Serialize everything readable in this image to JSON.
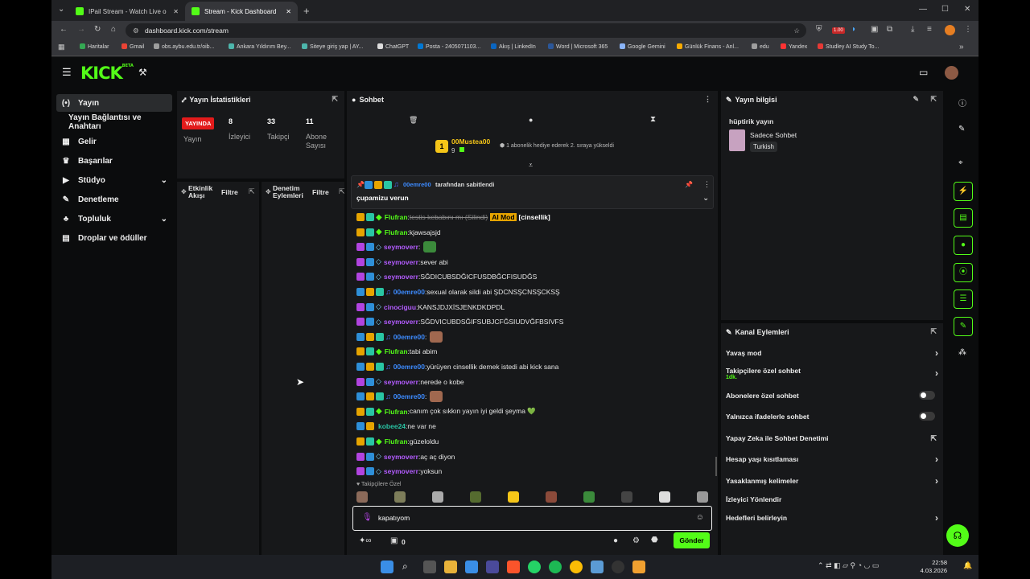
{
  "browser": {
    "tabs": [
      {
        "title": "IPail Stream - Watch Live o"
      },
      {
        "title": "Stream - Kick Dashboard"
      }
    ],
    "url": "dashboard.kick.com/stream",
    "bookmarks": [
      "Haritalar",
      "Gmail",
      "obs.aybu.edu.tr/oib...",
      "Ankara Yıldırım Bey...",
      "Siteye giriş yap | AY...",
      "ChatGPT",
      "Posta - 2405071103...",
      "Akış | LinkedIn",
      "Word | Microsoft 365",
      "Google Gemini",
      "Günlük Finans - Anl...",
      "edu",
      "Yandex",
      "Studley AI Study To..."
    ],
    "profile_badge": "1.00"
  },
  "kick": {
    "logo": "KICK",
    "logo_sup": "BETA",
    "sidebar": [
      {
        "icon": "(•)",
        "label": "Yayın"
      },
      {
        "icon": "",
        "label": "Yayın Bağlantısı ve Anahtarı"
      },
      {
        "icon": "▦",
        "label": "Gelir"
      },
      {
        "icon": "♛",
        "label": "Başarılar"
      },
      {
        "icon": "▶",
        "label": "Stüdyo"
      },
      {
        "icon": "✎",
        "label": "Denetleme"
      },
      {
        "icon": "♣",
        "label": "Topluluk"
      },
      {
        "icon": "▤",
        "label": "Droplar ve ödüller"
      }
    ],
    "stats": {
      "title": "Yayın İstatistikleri",
      "live_badge": "YAYINDA",
      "status_label": "Yayın",
      "viewers_value": "8",
      "viewers_label": "İzleyici",
      "followers_value": "33",
      "followers_label": "Takipçi",
      "subs_value": "11",
      "subs_label1": "Abone",
      "subs_label2": "Sayısı"
    },
    "activity": {
      "title1": "Etkinlik",
      "title2": "Akışı",
      "filter": "Filtre"
    },
    "moderation": {
      "title1": "Denetim",
      "title2": "Eylemleri",
      "filter": "Filtre"
    },
    "chat": {
      "title": "Sohbet",
      "gift_user": "00Mustea00",
      "gift_count": "9",
      "gift_rank": "1",
      "gift_text": "1 abonelik hediye ederek 2. sıraya yükseldi",
      "pinned_by_user": "00emre00",
      "pinned_by_text": "tarafından sabitlendi",
      "pinned_text": "çupamizu verun",
      "messages": [
        {
          "user": "Flufran",
          "color": "#53fc18",
          "text": "testis kebabını mı (Silindi)",
          "mod": "AI Mod",
          "tag": "[cinsellik]"
        },
        {
          "user": "Flufran",
          "color": "#53fc18",
          "text": "kjawsajsjd"
        },
        {
          "user": "seymoverr",
          "color": "#b35cff",
          "text": ""
        },
        {
          "user": "seymoverr",
          "color": "#b35cff",
          "text": "sever abi"
        },
        {
          "user": "seymoverr",
          "color": "#b35cff",
          "text": "SĞDICUBSDĞICFUSDBĞCFISUDĞS"
        },
        {
          "user": "00emre00",
          "color": "#3d8bff",
          "text": "sexual olarak sildi abi ŞDCNSŞCNSŞCKSŞ"
        },
        {
          "user": "cinociguu",
          "color": "#b35cff",
          "text": "KANSJDJXİSJENKDKDPDL"
        },
        {
          "user": "seymoverr",
          "color": "#b35cff",
          "text": "SĞDVICUBDSĞIFSUBJCFĞSIUDVĞFBSIVFS"
        },
        {
          "user": "00emre00",
          "color": "#3d8bff",
          "text": ""
        },
        {
          "user": "Flufran",
          "color": "#53fc18",
          "text": "tabi abim"
        },
        {
          "user": "00emre00",
          "color": "#3d8bff",
          "text": "yürüyen cinsellik demek istedi abi kick sana"
        },
        {
          "user": "seymoverr",
          "color": "#b35cff",
          "text": "nerede o kobe"
        },
        {
          "user": "00emre00",
          "color": "#3d8bff",
          "text": ""
        },
        {
          "user": "Flufran",
          "color": "#53fc18",
          "text": "canım çok sıkkın yayın iyi geldi şeyma 💚"
        },
        {
          "user": "kobee24",
          "color": "#29c5a4",
          "text": "ne var ne"
        },
        {
          "user": "Flufran",
          "color": "#53fc18",
          "text": "güzeloldu"
        },
        {
          "user": "seymoverr",
          "color": "#b35cff",
          "text": "aç aç diyon"
        },
        {
          "user": "seymoverr",
          "color": "#b35cff",
          "text": "yoksun"
        }
      ],
      "emote_section": "Takipçilere Özel",
      "input_value": "kapatıyom",
      "points": "0",
      "send_label": "Gönder"
    },
    "stream_info": {
      "title": "Yayın bilgisi",
      "stream_title": "hüptirik yayın",
      "category": "Sadece Sohbet",
      "language": "Turkish"
    },
    "channel_actions": {
      "title": "Kanal Eylemleri",
      "items": [
        {
          "label": "Yavaş mod",
          "control": "chevron"
        },
        {
          "label": "Takipçilere özel sohbet",
          "sub": "1dk.",
          "control": "chevron"
        },
        {
          "label": "Abonelere özel sohbet",
          "control": "toggle"
        },
        {
          "label": "Yalnızca ifadelerle sohbet",
          "control": "toggle"
        },
        {
          "label": "Yapay Zeka ile Sohbet Denetimi",
          "control": "external"
        },
        {
          "label": "Hesap yaşı kısıtlaması",
          "control": "chevron"
        },
        {
          "label": "Yasaklanmış kelimeler",
          "control": "chevron"
        },
        {
          "label": "İzleyici Yönlendir",
          "control": "none"
        },
        {
          "label": "Hedefleri belirleyin",
          "control": "chevron"
        }
      ]
    }
  },
  "taskbar": {
    "time": "22:58",
    "date": "4.03.2026"
  },
  "colors": {
    "kick_green": "#53fc18",
    "panel": "#17181a",
    "live_red": "#e31b1b"
  }
}
